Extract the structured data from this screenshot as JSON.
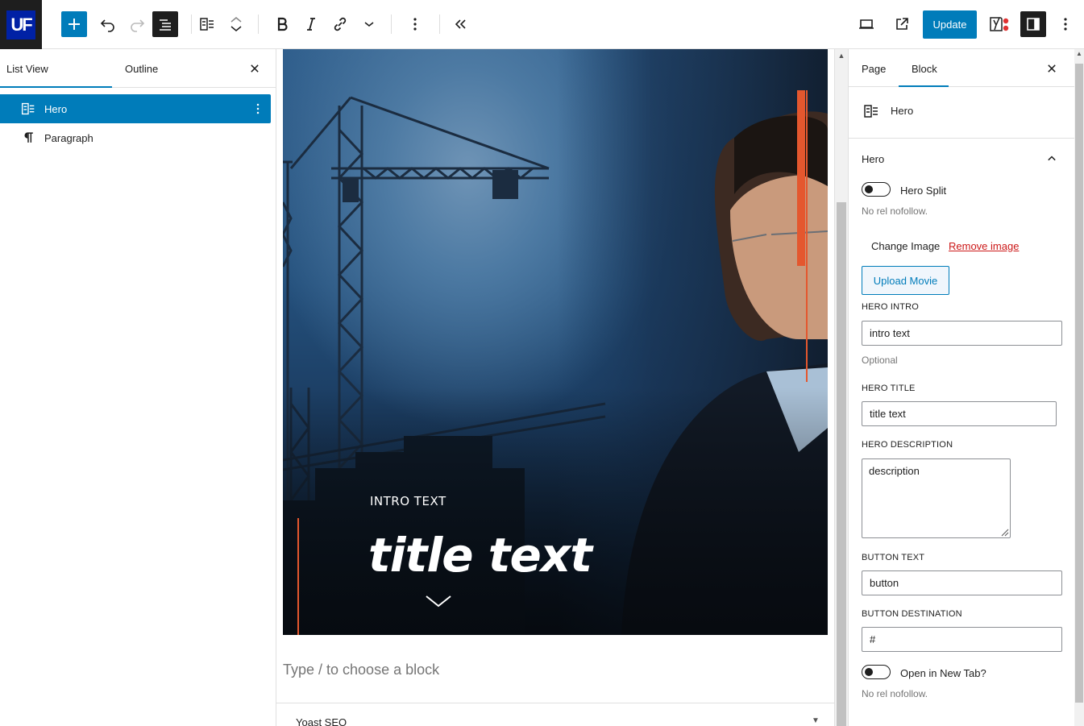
{
  "toolbar": {
    "logo_text": "UF",
    "update_label": "Update"
  },
  "list_view": {
    "tabs": [
      {
        "label": "List View"
      },
      {
        "label": "Outline"
      }
    ],
    "items": [
      {
        "label": "Hero",
        "icon": "hero-block-icon",
        "selected": true
      },
      {
        "label": "Paragraph",
        "icon": "paragraph-icon",
        "selected": false
      }
    ]
  },
  "canvas": {
    "hero": {
      "intro": "INTRO TEXT",
      "title": "title text"
    },
    "placeholder": "Type / to choose a block",
    "yoast_label": "Yoast SEO"
  },
  "sidebar": {
    "tabs": [
      {
        "label": "Page"
      },
      {
        "label": "Block"
      }
    ],
    "block_card_title": "Hero",
    "section_title": "Hero",
    "hero_split": {
      "label": "Hero Split",
      "help": "No rel nofollow."
    },
    "change_image_label": "Change Image",
    "remove_image_label": "Remove image",
    "upload_movie_label": "Upload Movie",
    "fields": {
      "hero_intro": {
        "label": "HERO INTRO",
        "value": "intro text",
        "help": "Optional"
      },
      "hero_title": {
        "label": "HERO TITLE",
        "value": "title text"
      },
      "hero_description": {
        "label": "HERO DESCRIPTION",
        "value": "description"
      },
      "button_text": {
        "label": "BUTTON TEXT",
        "value": "button"
      },
      "button_destination": {
        "label": "BUTTON DESTINATION",
        "value": "#"
      }
    },
    "open_new_tab": {
      "label": "Open in New Tab?",
      "help": "No rel nofollow."
    }
  },
  "colors": {
    "accent": "#007cba",
    "dark": "#1e1e1e",
    "hero_red": "#e4572e",
    "remove_link": "#cc1818"
  }
}
